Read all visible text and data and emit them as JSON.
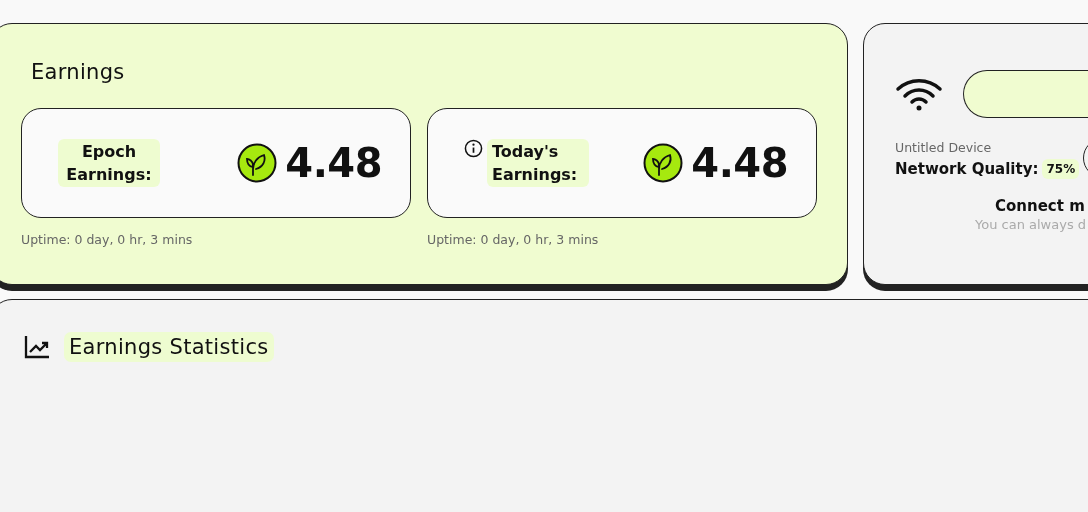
{
  "earnings": {
    "title": "Earnings",
    "tiles": [
      {
        "label": "Epoch Earnings:",
        "info": false,
        "value": "4.48",
        "uptime": "Uptime: 0 day, 0 hr, 3 mins"
      },
      {
        "label": "Today's Earnings:",
        "info": true,
        "value": "4.48",
        "uptime": "Uptime: 0 day, 0 hr, 3 mins"
      }
    ]
  },
  "device": {
    "name": "Untitled Device",
    "quality_label": "Network Quality:",
    "quality": "75%",
    "connect_title": "Connect m",
    "connect_hint": "You can always d"
  },
  "statistics": {
    "title": "Earnings Statistics"
  }
}
